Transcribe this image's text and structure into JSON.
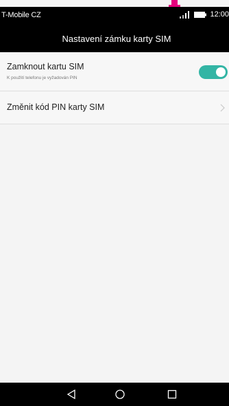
{
  "status_bar": {
    "carrier": "T-Mobile CZ",
    "time": "12:00",
    "icons": [
      "signal-icon",
      "battery-icon"
    ]
  },
  "header": {
    "title": "Nastavení zámku karty SIM"
  },
  "settings": {
    "lock_sim": {
      "title": "Zamknout kartu SIM",
      "subtitle": "K použití telefonu je vyžadován PIN",
      "enabled": true
    },
    "change_pin": {
      "title": "Změnit kód PIN karty SIM"
    }
  },
  "nav_bar": {
    "buttons": [
      "back-icon",
      "home-icon",
      "recent-apps-icon"
    ]
  },
  "colors": {
    "accent": "#33b5a5",
    "marker": "#e5007e",
    "bar": "#000000",
    "background": "#f4f4f4"
  }
}
